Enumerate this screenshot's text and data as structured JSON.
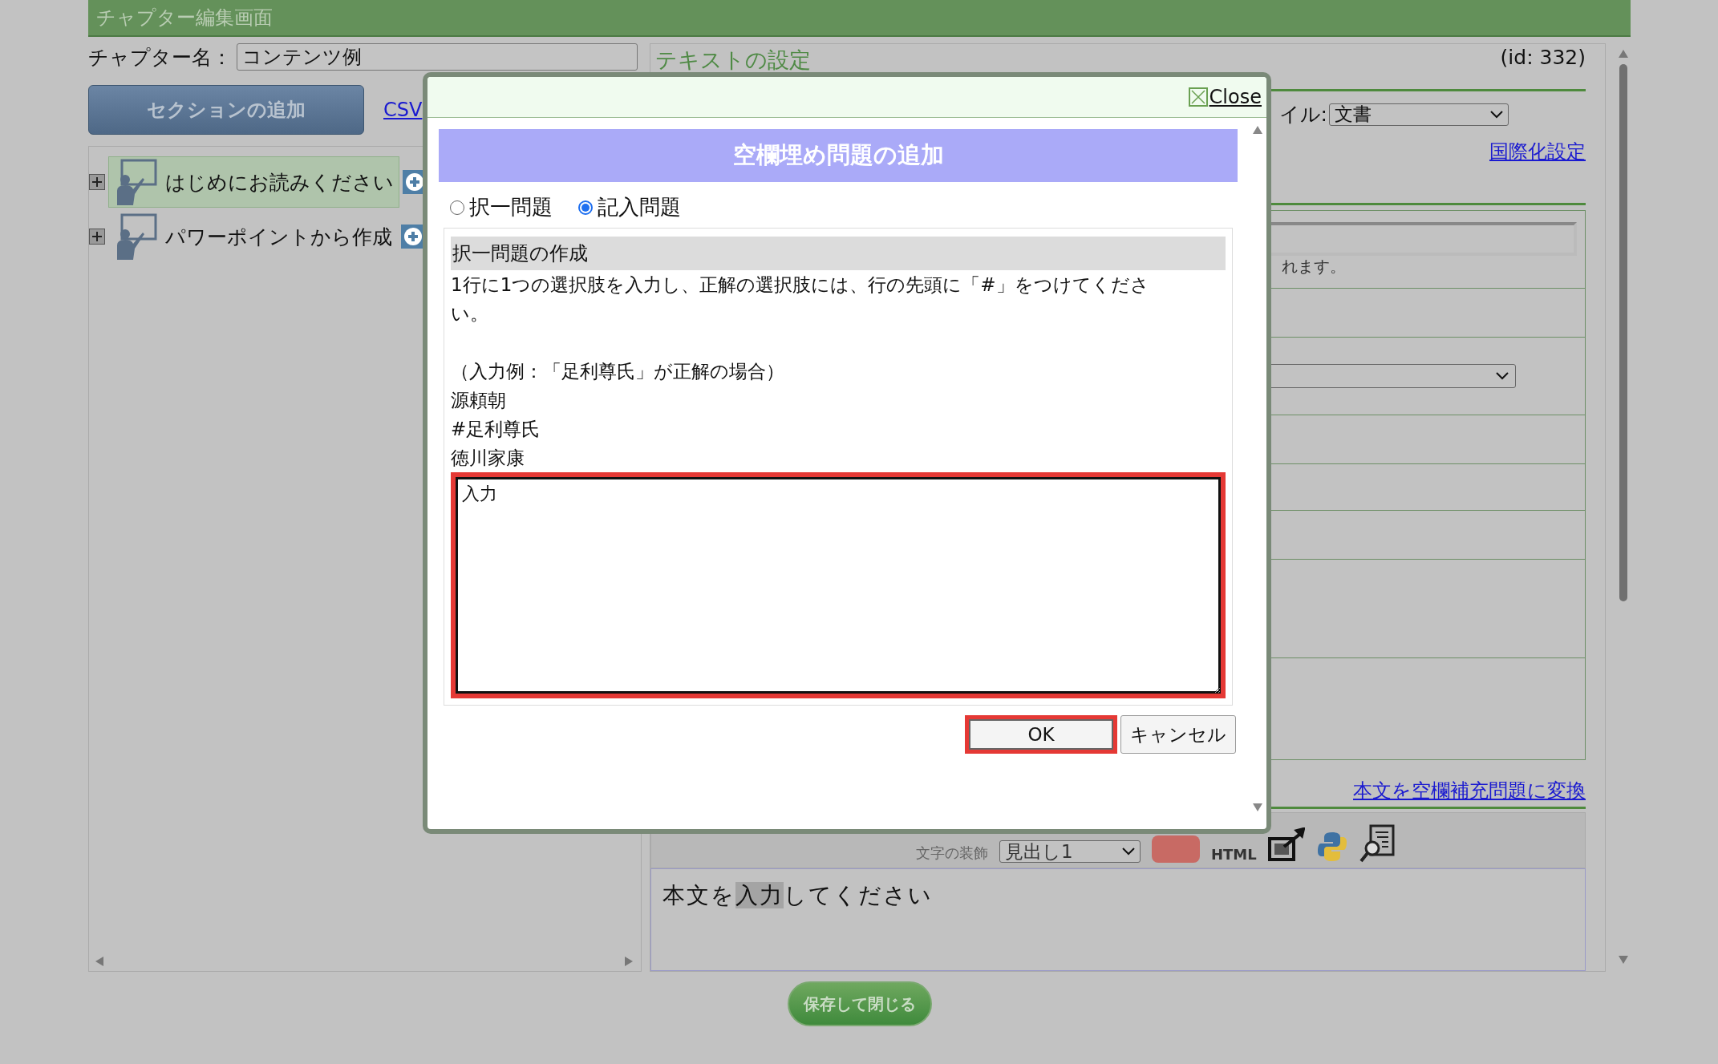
{
  "header": {
    "title": "チャプター編集画面"
  },
  "chapter": {
    "label": "チャプター名：",
    "value": "コンテンツ例"
  },
  "add_section_button": "セクションの追加",
  "csv_link": "CSV",
  "tree": [
    {
      "label": "はじめにお読みください",
      "selected": true,
      "expanded": false
    },
    {
      "label": "パワーポイントから作成",
      "selected": false,
      "expanded": false
    }
  ],
  "text_settings": {
    "title": "テキストの設定",
    "id": "(id: 332)",
    "style_label": "イル:",
    "style_value": "文書",
    "i18n_link": "国際化設定",
    "note": "れます。",
    "convert_link": "本文を空欄補充問題に変換"
  },
  "toolbar": {
    "decoration_label": "文字の装飾",
    "heading_value": "見出し1",
    "html_label": "HTML"
  },
  "editor": {
    "before": "本文を",
    "highlight": "入力",
    "after": "してください"
  },
  "save_button": "保存して閉じる",
  "dialog": {
    "close": "Close",
    "title": "空欄埋め問題の追加",
    "modes": [
      {
        "label": "択一問題",
        "selected": false
      },
      {
        "label": "記入問題",
        "selected": true
      }
    ],
    "section_heading": "択一問題の作成",
    "instructions": "1行に1つの選択肢を入力し、正解の選択肢には、行の先頭に「#」をつけてください。",
    "example_lines": [
      "（入力例：「足利尊氏」が正解の場合）",
      "源頼朝",
      "#足利尊氏",
      "徳川家康"
    ],
    "answer_value": "入力",
    "buttons": [
      {
        "label": "OK",
        "kind": "primary"
      },
      {
        "label": "キャンセル",
        "kind": "secondary"
      }
    ]
  }
}
